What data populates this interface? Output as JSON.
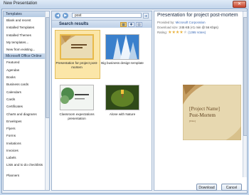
{
  "window": {
    "title": "New Presentation",
    "close_glyph": "✕"
  },
  "sidebar": {
    "header": "Templates",
    "items": [
      {
        "label": "Blank and recent"
      },
      {
        "label": "Installed Templates"
      },
      {
        "label": "Installed Themes"
      },
      {
        "label": "My templates..."
      },
      {
        "label": "New from existing..."
      }
    ],
    "section_header": "Microsoft Office Online",
    "online_items": [
      {
        "label": "Featured"
      },
      {
        "label": "Agendas"
      },
      {
        "label": "Books"
      },
      {
        "label": "Business cards"
      },
      {
        "label": "Calendars"
      },
      {
        "label": "Cards"
      },
      {
        "label": "Certificates"
      },
      {
        "label": "Charts and diagrams"
      },
      {
        "label": "Envelopes"
      },
      {
        "label": "Flyers"
      },
      {
        "label": "Forms"
      },
      {
        "label": "Invitations"
      },
      {
        "label": "Invoices"
      },
      {
        "label": "Labels"
      },
      {
        "label": "Lists and to do checklists"
      },
      {
        "label": "Planners"
      }
    ]
  },
  "search": {
    "value": "post",
    "back_glyph": "◀",
    "forward_glyph": "▶",
    "go_glyph": "➜"
  },
  "results": {
    "title": "Search results",
    "view_buttons": [
      "▦",
      "✱",
      "▤"
    ],
    "tiles": [
      {
        "caption": "Presentation for project post-mortem",
        "selected": true
      },
      {
        "caption": "Big business design template",
        "selected": false
      },
      {
        "caption": "Classroom expectations presentation",
        "selected": false
      },
      {
        "caption": "Alone with Nature",
        "selected": false
      }
    ]
  },
  "preview": {
    "title": "Presentation for project post-mortem",
    "provided_label": "Provided by:",
    "provider": "Microsoft Corporation",
    "size_label": "Download size:",
    "size_value": "245 KB (<1 min @ 56 Kbps)",
    "rating_label": "Rating:",
    "rating_stars": 4,
    "votes": "(1395 Votes)",
    "image_text": {
      "name": "[Project Name]",
      "subtitle": "Post-Mortem",
      "footer": "[Date]"
    }
  },
  "footer": {
    "download_label": "Download",
    "cancel_label": "Cancel"
  },
  "colors": {
    "accent_selected": "#f3d88a",
    "link": "#3a69b5",
    "star": "#e8b13a"
  }
}
